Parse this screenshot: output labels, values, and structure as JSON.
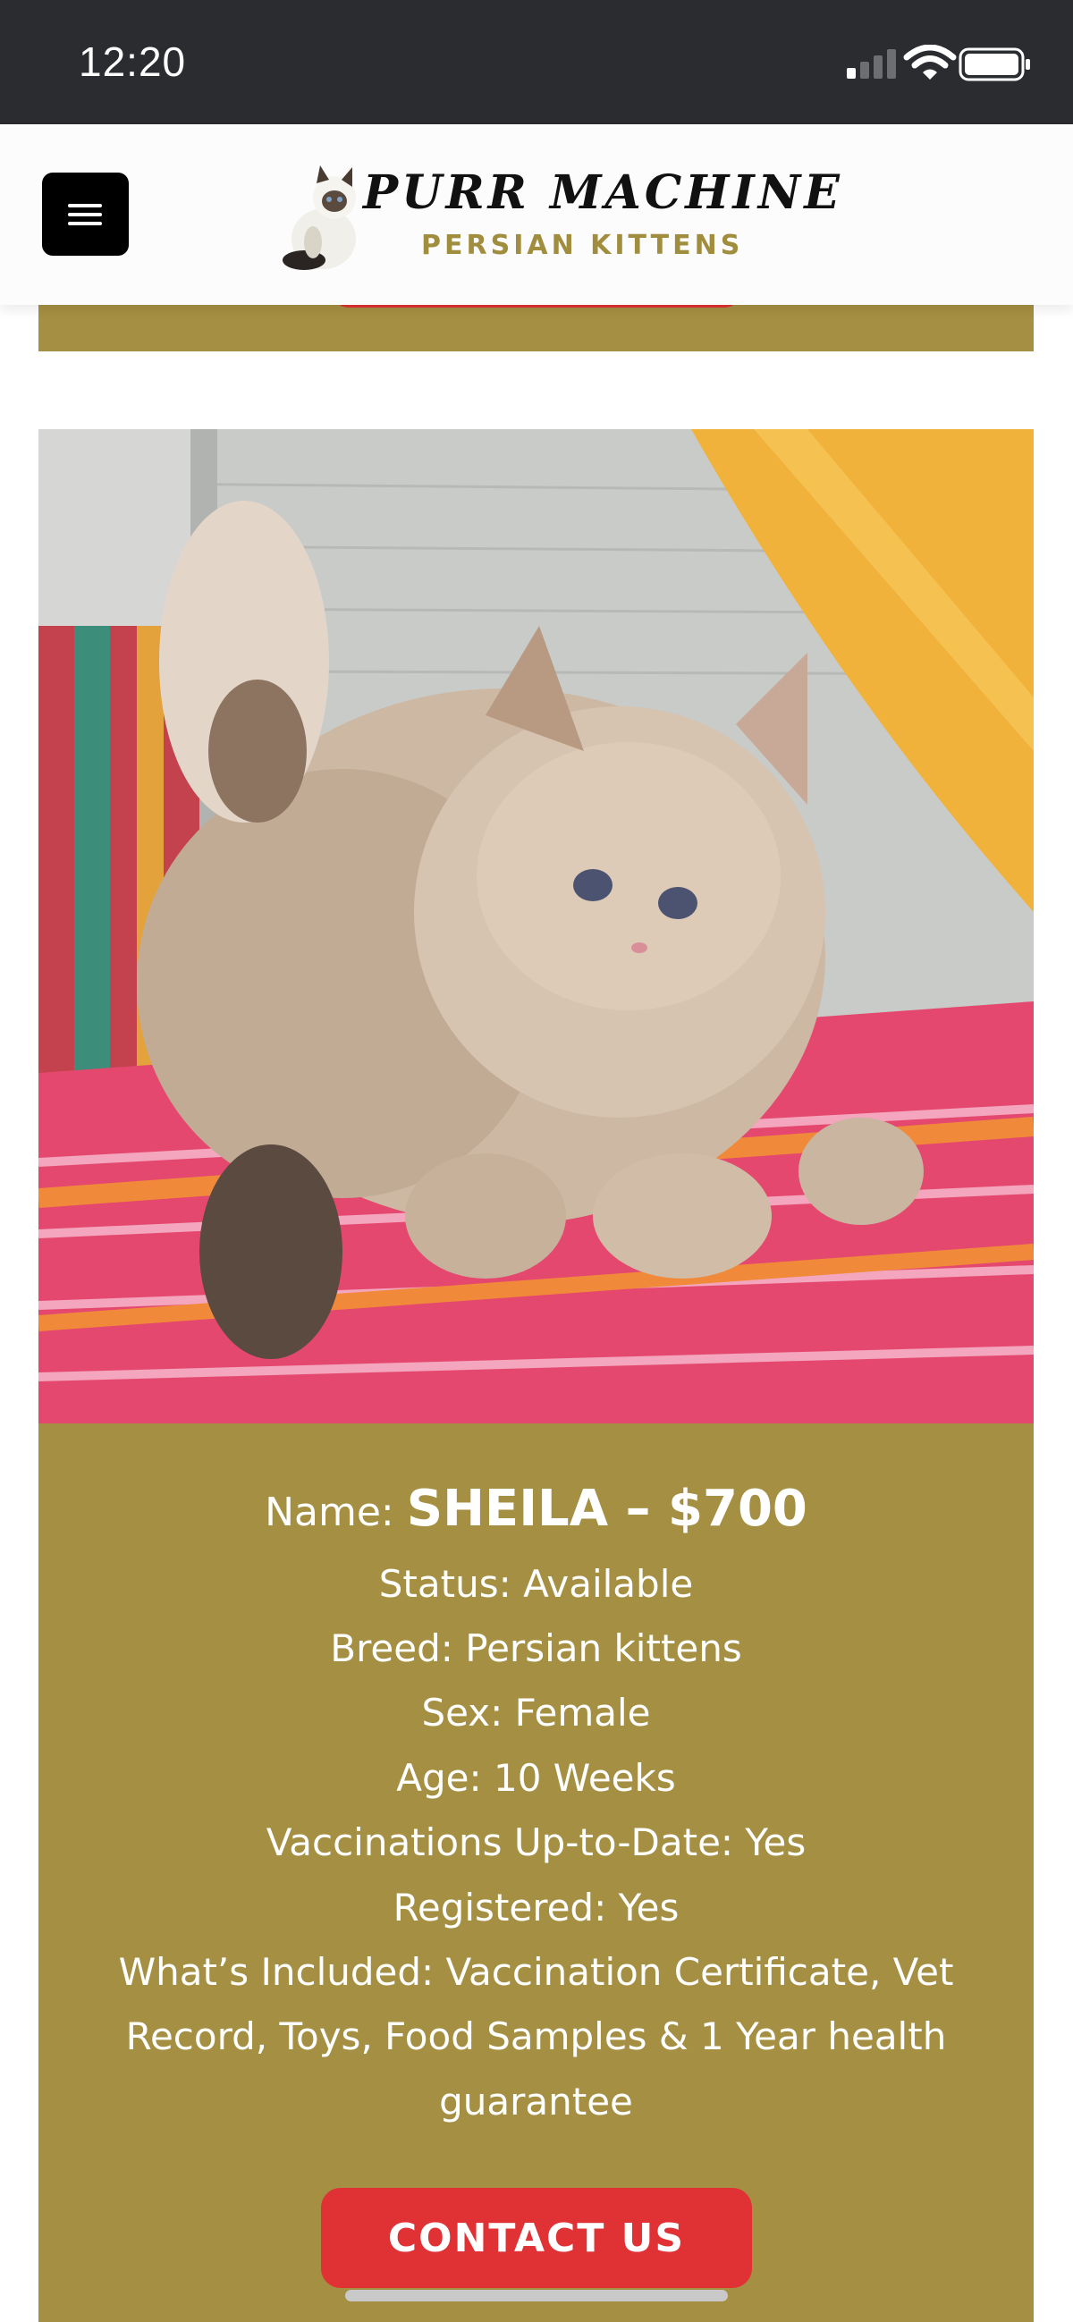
{
  "status_bar": {
    "time": "12:20"
  },
  "header": {
    "logo_title": "PURR MACHINE",
    "logo_subtitle": "PERSIAN KITTENS"
  },
  "kitten": {
    "name_label": "Name:",
    "name_value": "SHEILA  –  $700",
    "status": "Status: Available",
    "breed": "Breed: Persian kittens",
    "sex": "Sex: Female",
    "age": "Age: 10 Weeks",
    "vaccinations": "Vaccinations Up-to-Date: Yes",
    "registered": "Registered: Yes",
    "included_1": "What’s Included: Vaccination Certificate, Vet",
    "included_2": "Record, Toys, Food Samples & 1 Year health",
    "included_3": "guarantee",
    "contact_label": "CONTACT US"
  },
  "colors": {
    "accent_gold": "#a58f42",
    "button_red": "#e03134",
    "status_bar": "#2b2c30"
  }
}
